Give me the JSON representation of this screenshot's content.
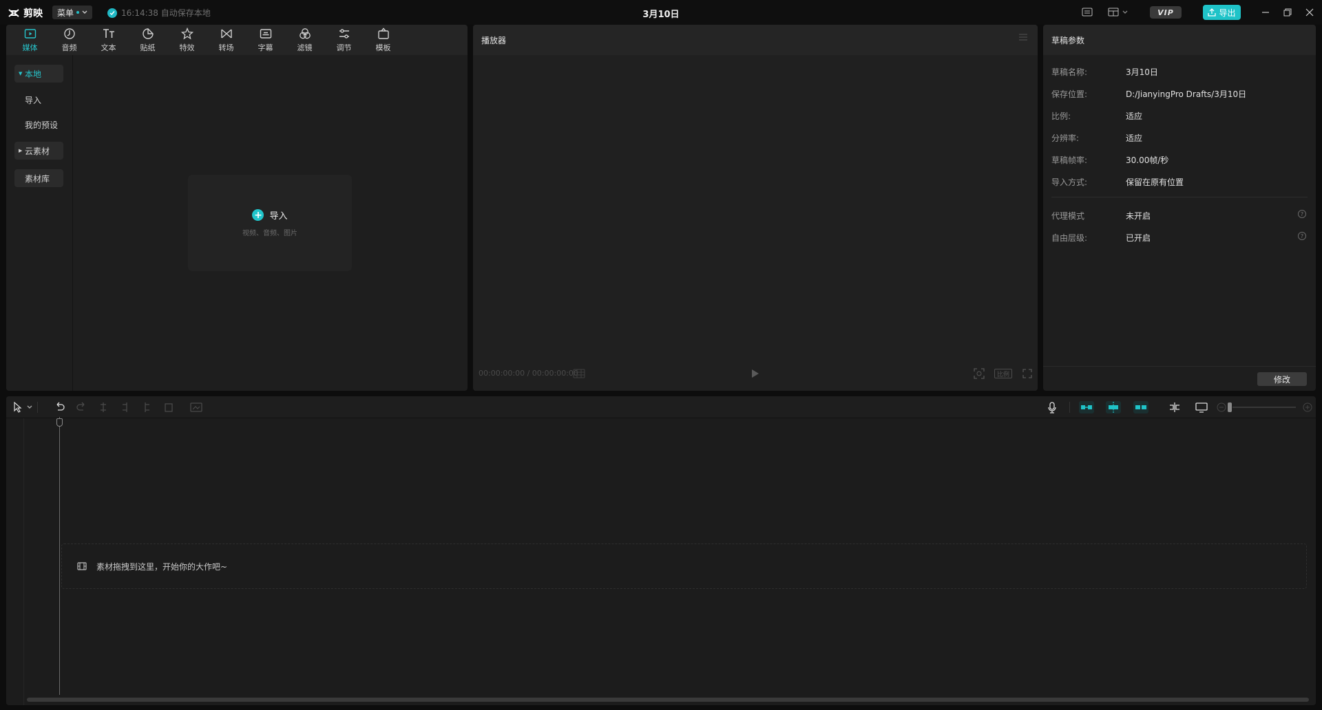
{
  "app": {
    "name": "剪映",
    "menu_label": "菜单",
    "save_status": "16:14:38 自动保存本地",
    "project_title": "3月10日",
    "vip_label": "VIP",
    "export_label": "导出",
    "accent_color": "#1fc3c8"
  },
  "media_tabs": [
    {
      "label": "媒体",
      "icon": "media-icon"
    },
    {
      "label": "音频",
      "icon": "audio-icon"
    },
    {
      "label": "文本",
      "icon": "text-icon"
    },
    {
      "label": "贴纸",
      "icon": "sticker-icon"
    },
    {
      "label": "特效",
      "icon": "effects-icon"
    },
    {
      "label": "转场",
      "icon": "transition-icon"
    },
    {
      "label": "字幕",
      "icon": "subtitle-icon"
    },
    {
      "label": "滤镜",
      "icon": "filter-icon"
    },
    {
      "label": "调节",
      "icon": "adjust-icon"
    },
    {
      "label": "模板",
      "icon": "template-icon"
    }
  ],
  "media_sidebar": [
    {
      "label": "本地"
    },
    {
      "label": "导入"
    },
    {
      "label": "我的预设"
    },
    {
      "label": "云素材"
    },
    {
      "label": "素材库"
    }
  ],
  "import_box": {
    "label": "导入",
    "hint": "视频、音频、图片"
  },
  "player": {
    "title": "播放器",
    "timecode": "00:00:00:00 / 00:00:00:00",
    "ratio_label": "比例"
  },
  "draft": {
    "title": "草稿参数",
    "rows": [
      {
        "key": "草稿名称:",
        "value": "3月10日"
      },
      {
        "key": "保存位置:",
        "value": "D:/JianyingPro Drafts/3月10日"
      },
      {
        "key": "比例:",
        "value": "适应"
      },
      {
        "key": "分辨率:",
        "value": "适应"
      },
      {
        "key": "草稿帧率:",
        "value": "30.00帧/秒"
      },
      {
        "key": "导入方式:",
        "value": "保留在原有位置"
      }
    ],
    "extra_rows": [
      {
        "key": "代理模式",
        "value": "未开启"
      },
      {
        "key": "自由层级:",
        "value": "已开启"
      }
    ],
    "modify_label": "修改"
  },
  "timeline": {
    "drop_hint": "素材拖拽到这里，开始你的大作吧~"
  }
}
